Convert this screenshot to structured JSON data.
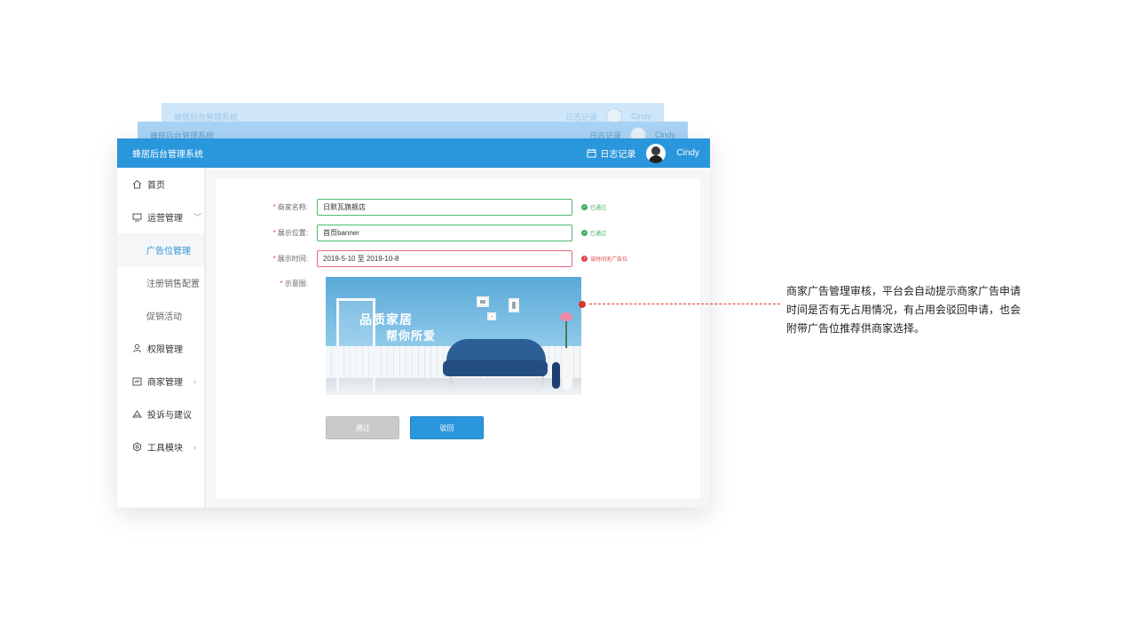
{
  "app": {
    "title": "蜂居后台管理系统",
    "log_label": "日志记录",
    "user_name": "Cindy",
    "accent": "#2a96dc"
  },
  "sidebar": {
    "items": [
      {
        "label": "首页",
        "icon": "home-icon"
      },
      {
        "label": "运营管理",
        "icon": "monitor-icon",
        "chevron": "﹀"
      },
      {
        "label": "广告位管理",
        "sub": true,
        "active": true
      },
      {
        "label": "注册销售配置",
        "sub": true
      },
      {
        "label": "促销活动",
        "sub": true
      },
      {
        "label": "权限管理",
        "icon": "user-icon"
      },
      {
        "label": "商家管理",
        "icon": "store-icon",
        "chevron": "›"
      },
      {
        "label": "投诉与建议",
        "icon": "feedback-icon"
      },
      {
        "label": "工具模块",
        "icon": "tool-icon",
        "chevron": "›"
      }
    ]
  },
  "form": {
    "merchant": {
      "label": "商家名称:",
      "value": "日默瓦旗舰店",
      "status": "已通过"
    },
    "position": {
      "label": "展示位置:",
      "value": "首页banner",
      "status": "已通过"
    },
    "time": {
      "label": "展示时间:",
      "value": "2019-5-10 至 2019-10-8",
      "status": "该时间无广告位"
    },
    "preview": {
      "label": "示意图:",
      "slogan1": "品质家居",
      "slogan2": "帮你所爱"
    }
  },
  "buttons": {
    "pass": "通过",
    "reject": "驳回"
  },
  "annotation": {
    "text": "商家广告管理审核，平台会自动提示商家广告申请时间是否有无占用情况，有占用会驳回申请，也会附带广告位推荐供商家选择。"
  }
}
